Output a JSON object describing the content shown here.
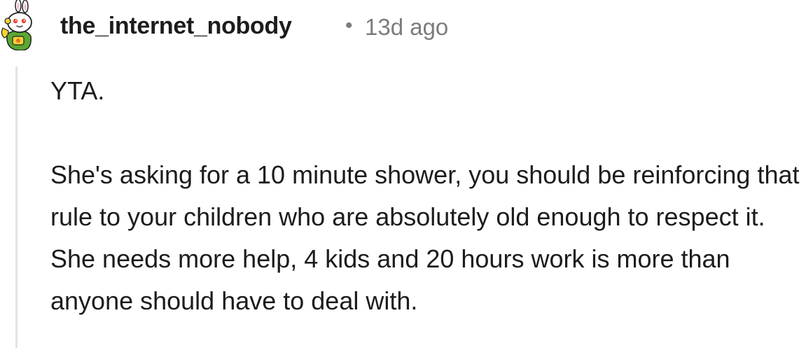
{
  "comment": {
    "author": {
      "username": "the_internet_nobody",
      "avatar_icon": "snoo-avatar-icon"
    },
    "separator": "•",
    "timestamp": "13d ago",
    "body": {
      "paragraphs": [
        "YTA.",
        "She's asking for a 10 minute shower, you should be reinforcing that rule to your children who are absolutely old enough to respect it. She needs more help, 4 kids and 20 hours work is more than anyone should have to deal with."
      ]
    },
    "colors": {
      "username": "#1c1c1c",
      "meta": "#7c7c7c",
      "thread_line": "#e3e3e3",
      "avatar_green": "#5aa832",
      "avatar_yellow": "#f2d237"
    }
  }
}
